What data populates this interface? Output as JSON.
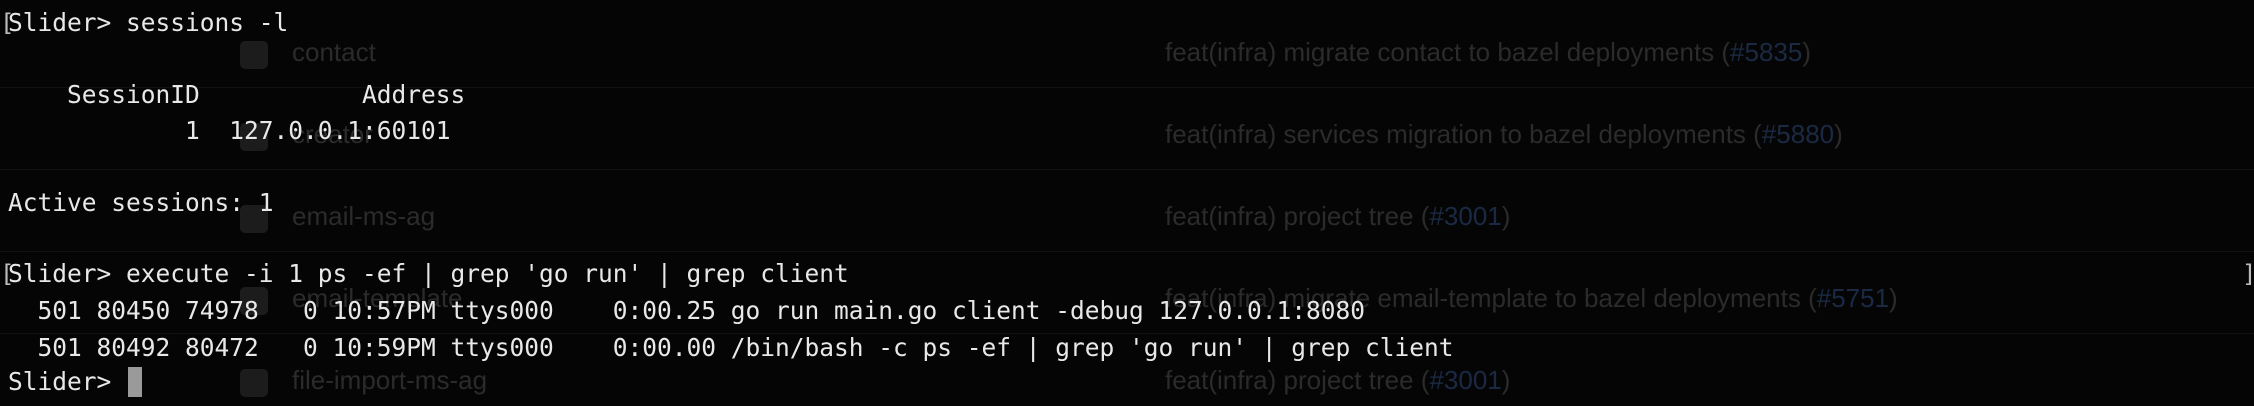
{
  "background_window": {
    "rows": [
      {
        "name": "contact",
        "commit": "feat(infra) migrate contact to bazel deployments (",
        "pr": "#5835",
        "tail": ")"
      },
      {
        "name": "creator",
        "commit": "feat(infra) services migration to bazel deployments (",
        "pr": "#5880",
        "tail": ")"
      },
      {
        "name": "email-ms-ag",
        "commit": "feat(infra) project tree (",
        "pr": "#3001",
        "tail": ")"
      },
      {
        "name": "email-template",
        "commit": "feat(infra) migrate email-template to bazel deployments (",
        "pr": "#5751",
        "tail": ")"
      },
      {
        "name": "file-import-ms-ag",
        "commit": "feat(infra) project tree (",
        "pr": "#3001",
        "tail": ")"
      }
    ]
  },
  "terminal": {
    "lines": [
      "Slider> sessions -l",
      "",
      "    SessionID           Address",
      "            1  127.0.0.1:60101",
      "",
      "Active sessions: 1",
      "",
      "Slider> execute -i 1 ps -ef | grep 'go run' | grep client",
      "  501 80450 74978   0 10:57PM ttys000    0:00.25 go run main.go client -debug 127.0.0.1:8080",
      "  501 80492 80472   0 10:59PM ttys000    0:00.00 /bin/bash -c ps -ef | grep 'go run' | grep client"
    ],
    "prompt": "Slider> ",
    "bracket_left": "[",
    "bracket_right": "]"
  },
  "colors": {
    "terminal_bg": "#050505",
    "text": "#e8e8e8",
    "cursor": "#9a9a9a"
  }
}
